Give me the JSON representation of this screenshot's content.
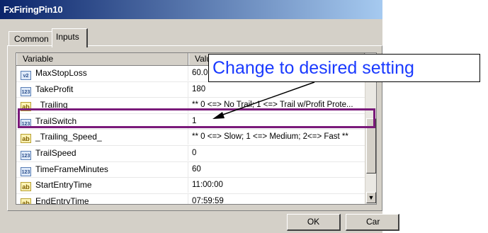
{
  "window": {
    "title": "FxFiringPin10"
  },
  "tabs": [
    {
      "label": "Common"
    },
    {
      "label": "Inputs"
    }
  ],
  "grid": {
    "columns": {
      "variable": "Variable",
      "value": "Valu"
    },
    "rows": [
      {
        "icon": "v2",
        "name": "MaxStopLoss",
        "value": "60.0"
      },
      {
        "icon": "123",
        "name": "TakeProfit",
        "value": "180"
      },
      {
        "icon": "ab",
        "name": "_Trailing_",
        "value": "** 0 <=> No Trail; 1 <=> Trail w/Profit Prote..."
      },
      {
        "icon": "123",
        "name": "TrailSwitch",
        "value": "1"
      },
      {
        "icon": "ab",
        "name": "_Trailing_Speed_",
        "value": "** 0 <=> Slow; 1 <=> Medium; 2<=> Fast **"
      },
      {
        "icon": "123",
        "name": "TrailSpeed",
        "value": "0"
      },
      {
        "icon": "123",
        "name": "TimeFrameMinutes",
        "value": "60"
      },
      {
        "icon": "ab",
        "name": "StartEntryTime",
        "value": "11:00:00"
      },
      {
        "icon": "ab",
        "name": "EndEntryTime",
        "value": "07:59:59"
      }
    ],
    "scroll_down_symbol": "▼"
  },
  "buttons": {
    "ok": "OK",
    "cancel": "Car"
  },
  "annotation": {
    "text": "Change to desired setting",
    "highlight_color": "#7a1a7a",
    "text_color": "#1a3aff"
  },
  "colors": {
    "title_gradient_start": "#0a246a",
    "title_gradient_end": "#a6caf0",
    "dialog_bg": "#d4d0c8"
  }
}
